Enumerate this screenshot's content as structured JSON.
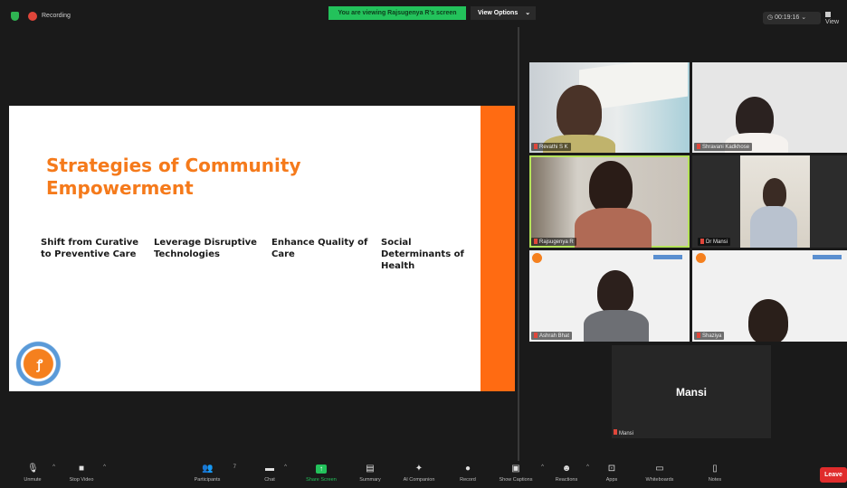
{
  "topbar": {
    "recording_label": "Recording",
    "viewing_banner": "You are viewing Rajsugenya R's screen",
    "view_options_label": "View Options",
    "view_options_chevron": "⌄",
    "timer": "00:19:16",
    "timer_chevron": "⌄",
    "view_label": "View"
  },
  "slide": {
    "title": "Strategies of Community Empowerment",
    "columns": [
      "Shift from Curative to Preventive Care",
      "Leverage Disruptive Technologies",
      "Enhance Quality of Care",
      "Social Determinants of Health"
    ],
    "accent_color": "#ff6b12",
    "title_color": "#f57a1b"
  },
  "participants": [
    {
      "name": "Revathi S K"
    },
    {
      "name": "Shravani Kadkhose"
    },
    {
      "name": "Rajsugenya R"
    },
    {
      "name": "Dr Mansi"
    },
    {
      "name": "Ashrah Bhat"
    },
    {
      "name": "Shaziya"
    },
    {
      "name": "Mansi",
      "display_big": "Mansi"
    }
  ],
  "toolbar": {
    "items": [
      {
        "label": "Unmute",
        "icon": "microphone-muted-icon"
      },
      {
        "label": "Stop Video",
        "icon": "video-camera-icon"
      },
      {
        "label": "Participants",
        "icon": "participants-icon",
        "count": "7"
      },
      {
        "label": "Chat",
        "icon": "chat-icon"
      },
      {
        "label": "Share Screen",
        "icon": "share-screen-icon"
      },
      {
        "label": "Summary",
        "icon": "summary-icon"
      },
      {
        "label": "AI Companion",
        "icon": "ai-companion-icon"
      },
      {
        "label": "Record",
        "icon": "record-icon"
      },
      {
        "label": "Show Captions",
        "icon": "captions-icon"
      },
      {
        "label": "Reactions",
        "icon": "reactions-icon"
      },
      {
        "label": "Apps",
        "icon": "apps-icon"
      },
      {
        "label": "Whiteboards",
        "icon": "whiteboard-icon"
      },
      {
        "label": "Notes",
        "icon": "notes-icon"
      }
    ],
    "leave_label": "Leave",
    "leave_color": "#e02c2c",
    "share_color": "#23c25b"
  }
}
